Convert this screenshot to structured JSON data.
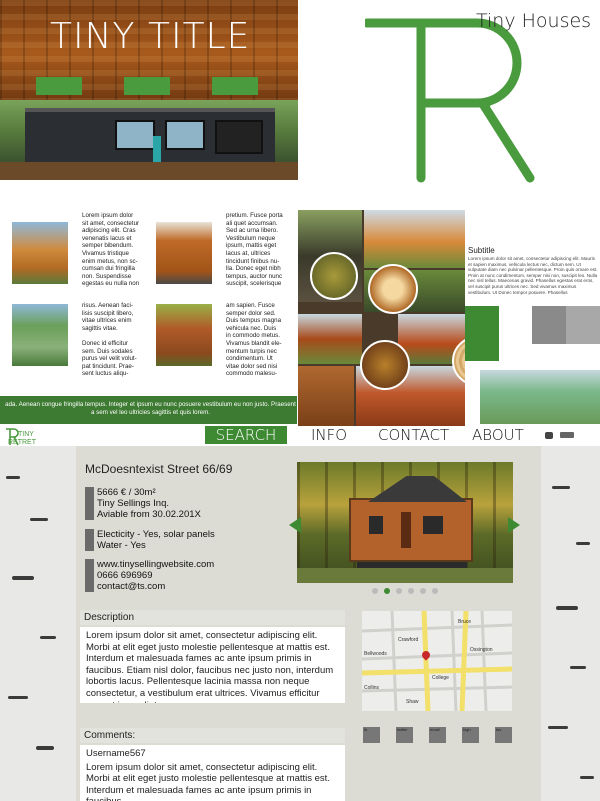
{
  "hero": {
    "title": "TINY TITLE"
  },
  "spread": {
    "paragraphs": [
      "Lorem ipsum dolor\nsit amet, consectetur\nadipiscing elit. Cras\nvenenatis lacus et\nsemper bibendum.\nVivamus tristique\nenim metus, non sc-\ncumsan dui fringilla\nnon. Suspendisse\negestas eu nulla non",
      "pretium. Fusce porta\nali quet accumsan.\nSed ac urna libero.\nVestibulum neque\nipsum, mattis eget\nlacus at, ultrices\ntincidunt finibus nu-\nlla. Donec eget nibh\ntempus, auctor nunc\nsuscipit, scelerisque",
      "risus. Aenean faci-\nlisis suscipit libero,\nvitae ultrices enim\nsagittis vitae.\n\nDonec id efficitur\nsem. Duis sodales\npurus vel velit volut-\npat tincidunt. Prae-\nsent luctus aliqu-",
      "am sapien. Fusce\nsemper dolor sed.\nDuis tempus magna\nvehicula nec. Duis\nin commodo metus.\nVivamus blandit ele-\nmentum turpis nec\ncondimentum. Ut\nvitae dolor sed nisi\ncommodo malesu-"
    ],
    "band_text": "ada. Aenean congue fringilla tempus. Integer et ipsum eu nunc posuere vestibulum eu non justo. Praesent a sem vel leo ultricies sagittis et quis lorem.",
    "tiny_houses_title": "Tiny Houses",
    "subtitle": "Subtitle",
    "subtitle_text": "Lorem ipsum dolor sit amet, consectetur adipiscing elit. Mauris et sapien maximus, vehicula lectus nec, dictum sem. Ut vulputate diam nec pulvinar pellentesque. Proin quis ornare est. Proin at nunc condimentum, semper nisi non, suscipit leo. Nulla nec nisl tellus. Maecenas gravid. Phasellus egestas erat eros, vel suscipit purus ultrices nec. Sed vivamus maximus vestibulum. Ut Donec tempor posuere. Phasellus"
  },
  "nav": {
    "logo_top": "TINY",
    "logo_bottom": "RETRET",
    "items": [
      "SEARCH",
      "INFO",
      "CONTACT",
      "ABOUT"
    ]
  },
  "listing": {
    "address": "McDoesntexist Street 66/69",
    "price_lines": [
      "5666 € / 30m²",
      "Tiny Sellings Inq.",
      "Aviable from 30.02.201X"
    ],
    "utility_lines": [
      "Electicity - Yes, solar panels",
      "Water - Yes"
    ],
    "contact_lines": [
      "www.tinysellingwebsite.com",
      "0666 696969",
      "contact@ts.com"
    ],
    "description_label": "Description",
    "description_text": "Lorem ipsum dolor sit amet, consectetur adipiscing elit. Morbi at elit eget justo molestie pellentesque at mattis est. Interdum et malesuada fames ac ante ipsum primis in faucibus. Etiam nisl dolor, faucibus nec justo non, interdum lobortis lacus. Pellentesque lacinia massa non neque consectetur, a vestibulum erat ultrices. Vivamus efficitur eros et imperdiet or-",
    "comments_label": "Comments:",
    "comment_user": "Username567",
    "comment_text": "Lorem ipsum dolor sit amet, consectetur adipiscing elit. Morbi at elit eget justo molestie pellentesque at mattis est. Interdum et malesuada fames ac ante ipsum primis in faucibus.",
    "map_streets": [
      "Bruce",
      "Bellwoods",
      "Crawford",
      "Shaw",
      "College",
      "Collins",
      "Ossington"
    ],
    "mini_labels": [
      "fb",
      "twitter",
      "email",
      "high",
      "fav"
    ]
  },
  "colors": {
    "brand_green": "#4a9a3e",
    "nav_green": "#3d8a33",
    "panel_grey": "#dcdcd4"
  }
}
